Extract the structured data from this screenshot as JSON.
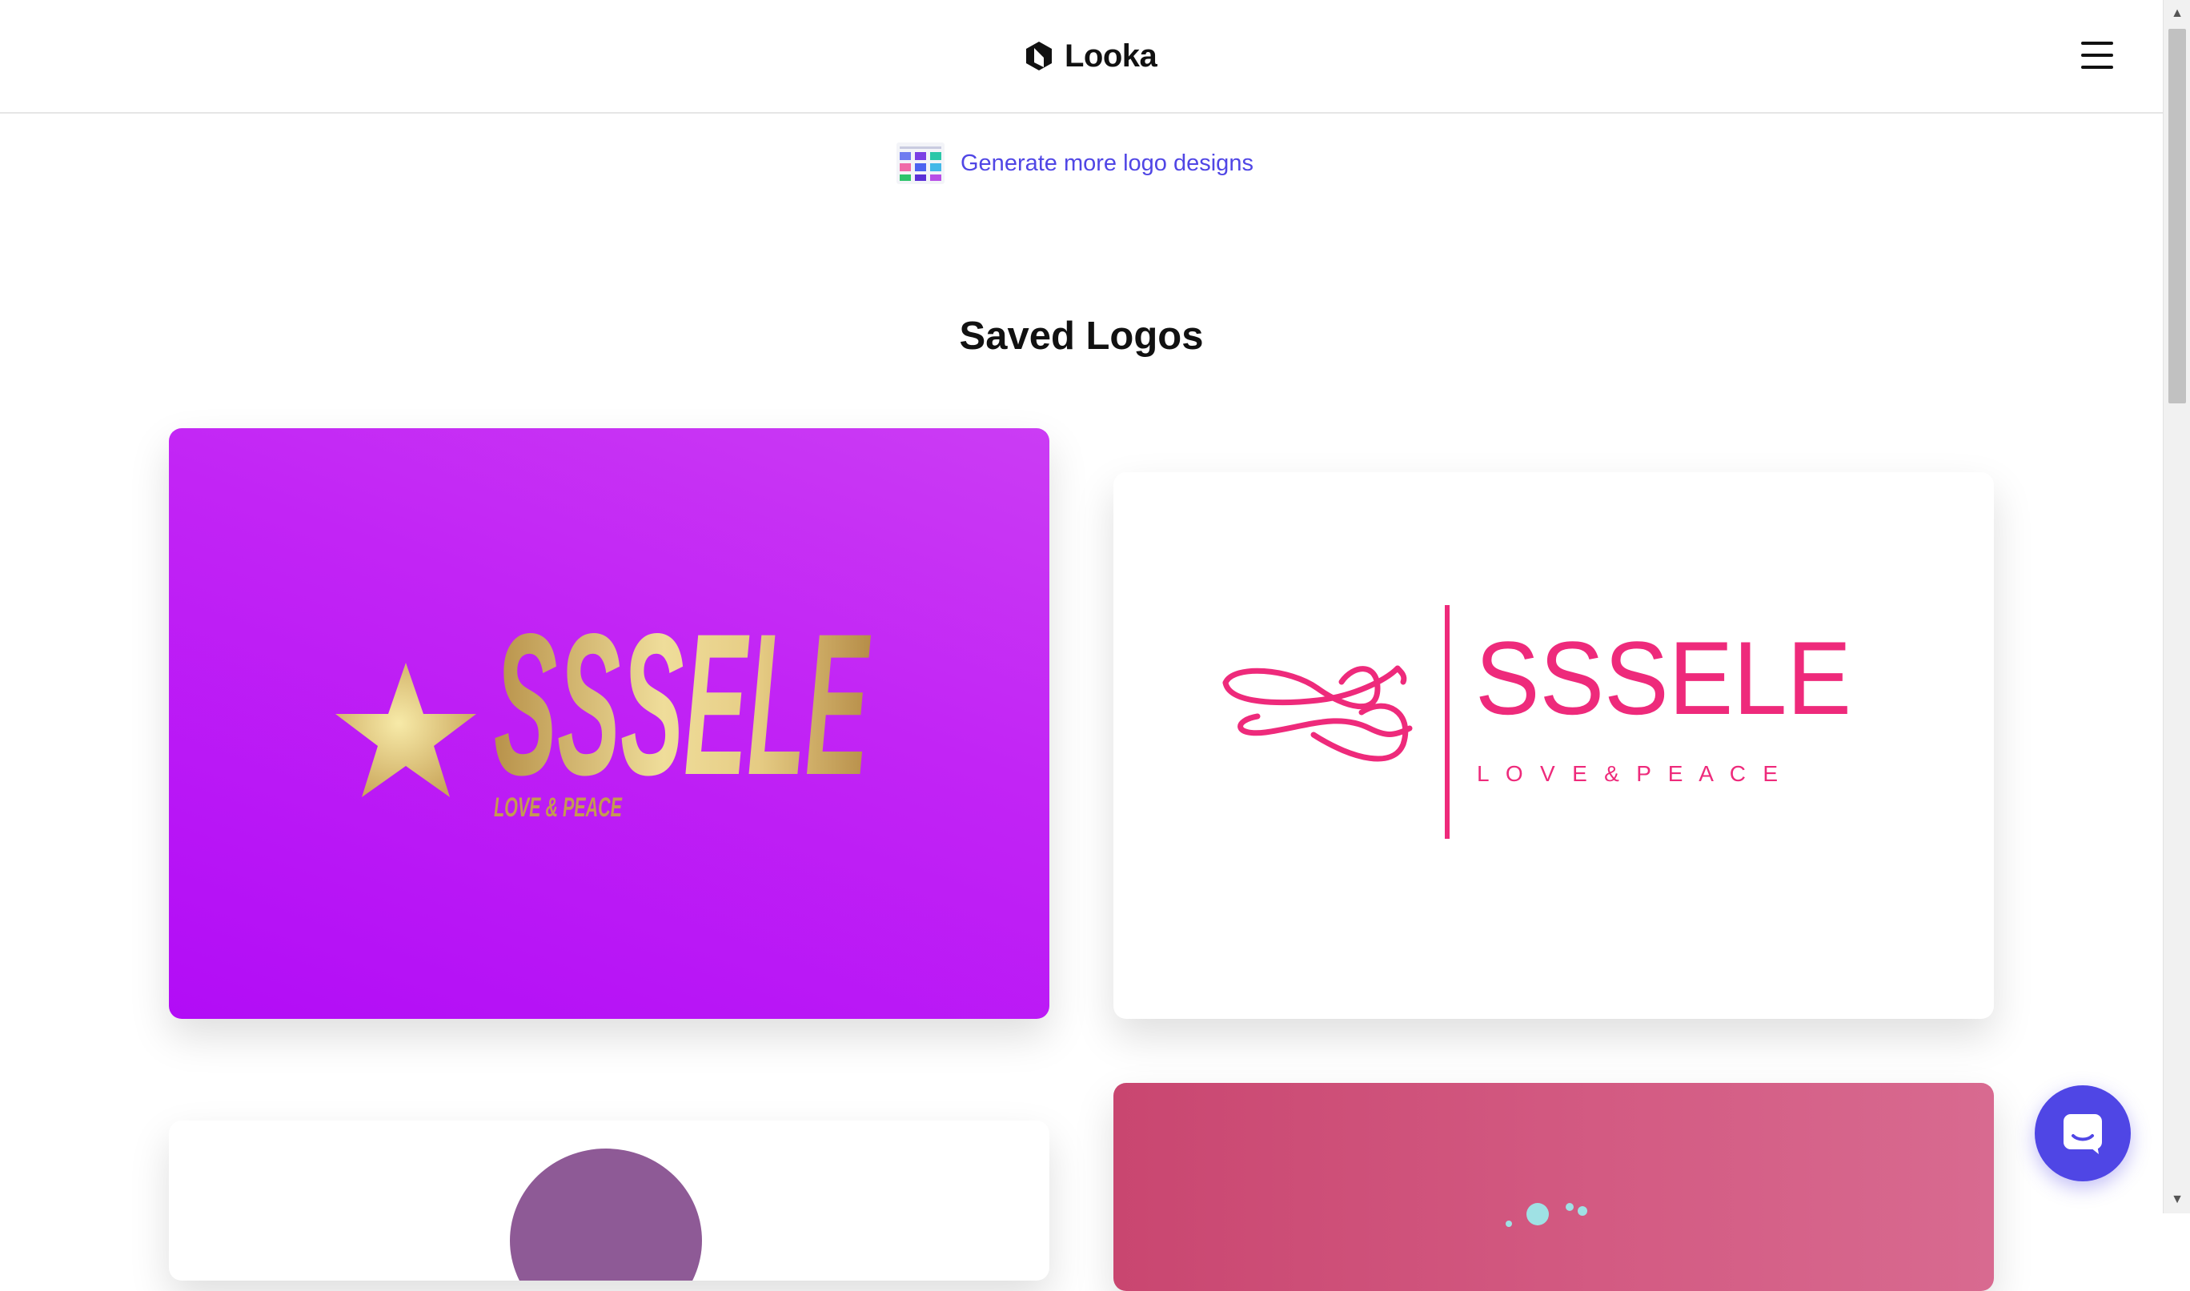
{
  "header": {
    "brand_name": "Looka",
    "brand_icon": "looka-logo-icon",
    "menu_icon": "hamburger-menu-icon"
  },
  "generate_link": {
    "label": "Generate more logo designs",
    "icon": "logo-grid-thumbnail-icon",
    "color": "#5046e5"
  },
  "page_title": "Saved Logos",
  "logos": [
    {
      "name": "SSSELE",
      "slogan": "LOVE & PEACE",
      "style": "gold italic wordmark with gold star on purple gradient",
      "background": "#c224f5",
      "text_color": "#d8b45c"
    },
    {
      "name": "SSSELE",
      "slogan": "L O V E   &   P E A C E",
      "style": "pink wordmark with infinity swirl and vertical divider on white",
      "background": "#ffffff",
      "text_color": "#ee2a7b"
    },
    {
      "name": "",
      "slogan": "",
      "style": "partially visible card, purple circle emblem",
      "background": "#ffffff"
    },
    {
      "name": "",
      "slogan": "",
      "style": "partially visible card on pink gradient with teal dots",
      "background": "#d05478"
    }
  ],
  "chat_widget": {
    "icon": "chat-bubble-icon",
    "color": "#4f46e5"
  },
  "scrollbar": {
    "up_icon": "▲",
    "down_icon": "▼"
  }
}
